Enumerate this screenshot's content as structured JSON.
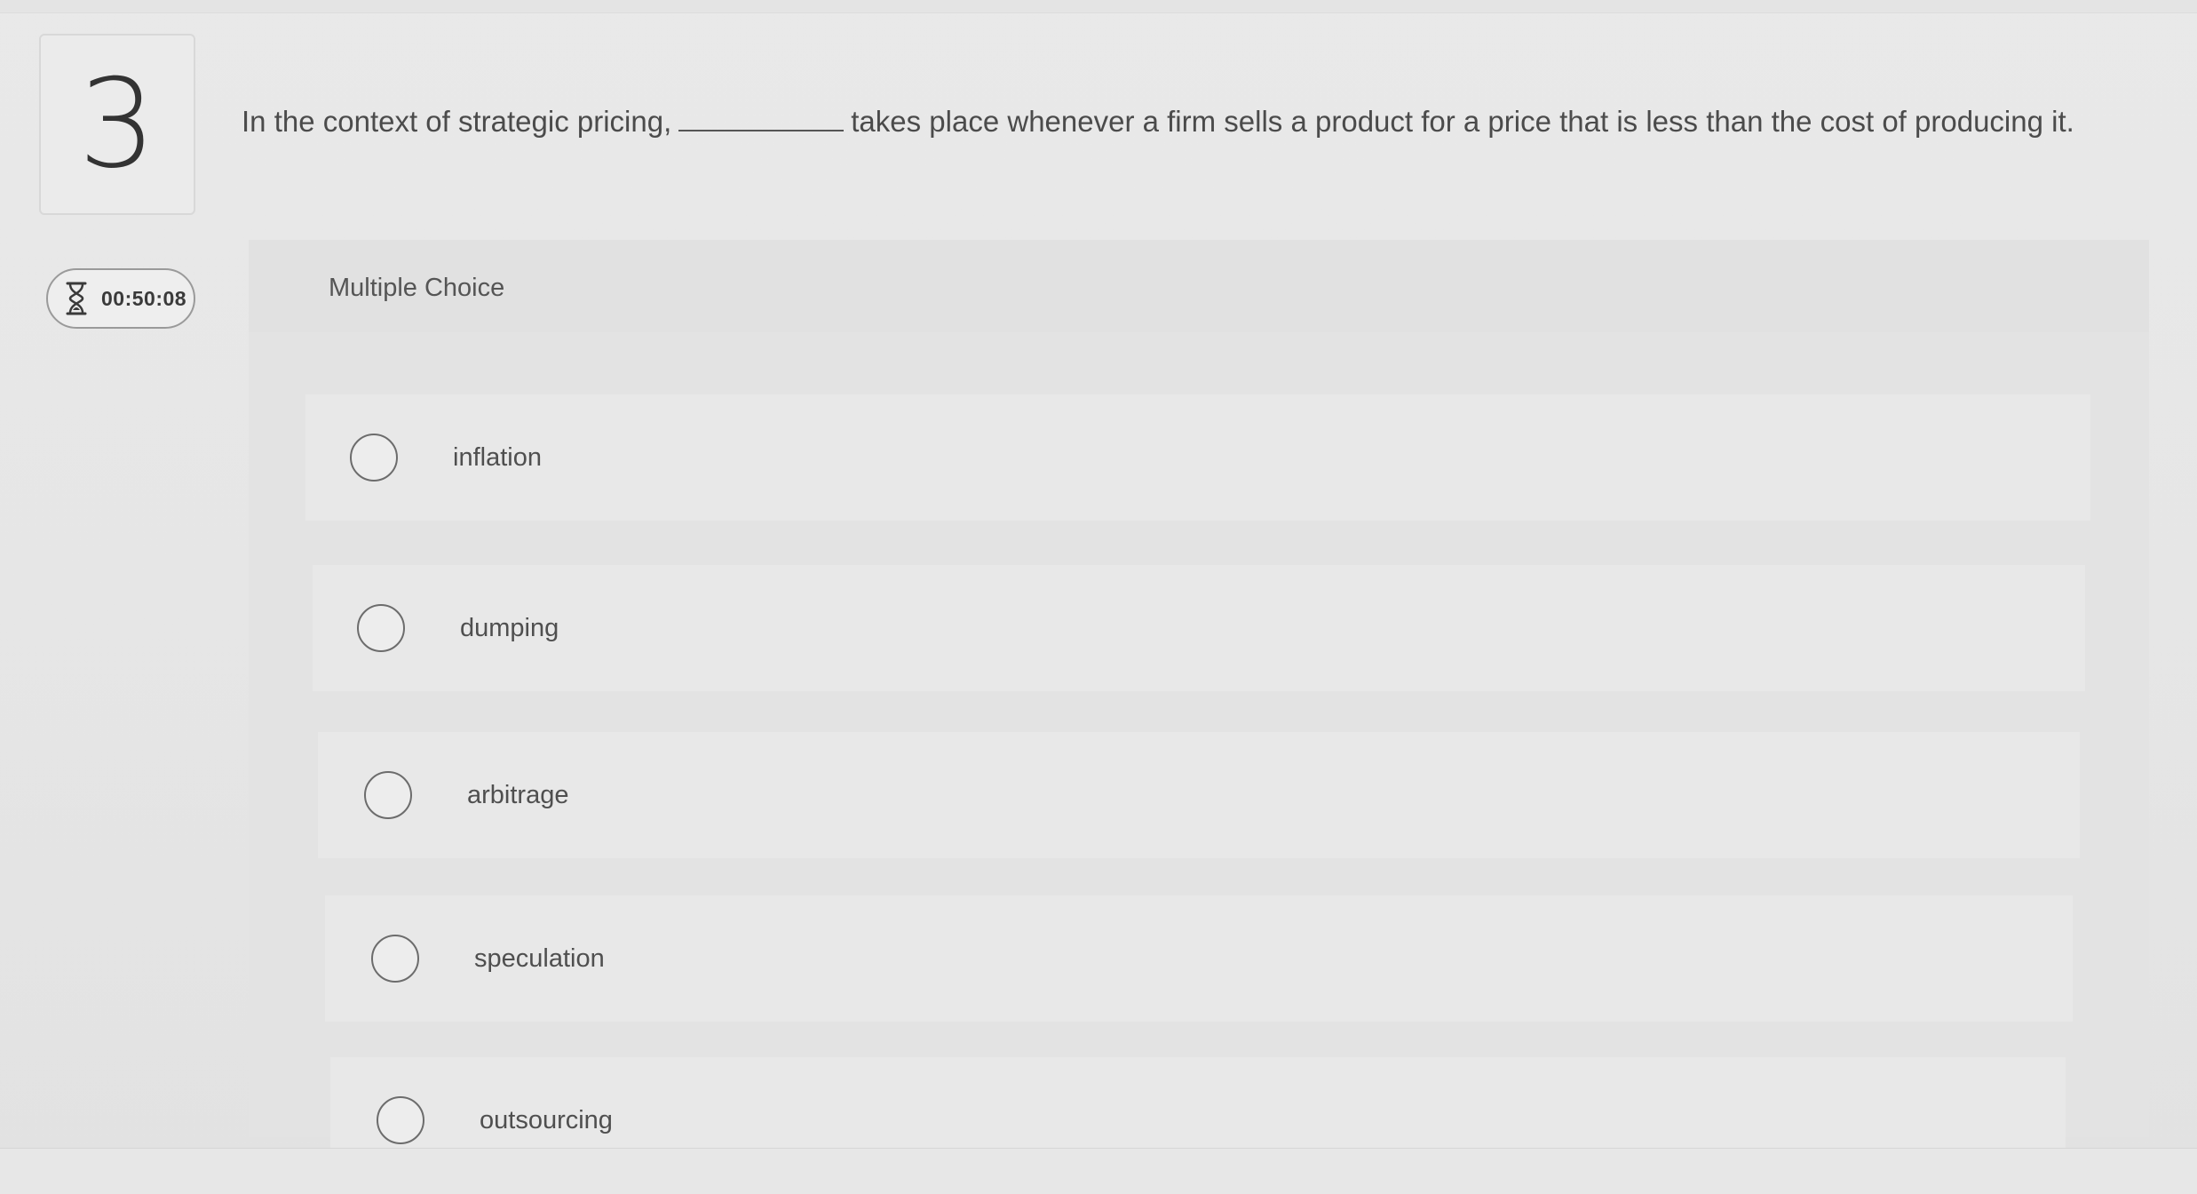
{
  "question": {
    "number": "3",
    "text_before": "In the context of strategic pricing,",
    "text_after": "takes place whenever a firm sells a product for a price that is less than the cost of producing it."
  },
  "timer": {
    "icon": "hourglass-icon",
    "value": "00:50:08"
  },
  "answer_type": "Multiple Choice",
  "options": [
    {
      "label": "inflation"
    },
    {
      "label": "dumping"
    },
    {
      "label": "arbitrage"
    },
    {
      "label": "speculation"
    },
    {
      "label": "outsourcing"
    }
  ],
  "colors": {
    "background": "#e8e8e8",
    "text": "#4b4b4b",
    "radio_border": "#6c6c6c"
  }
}
